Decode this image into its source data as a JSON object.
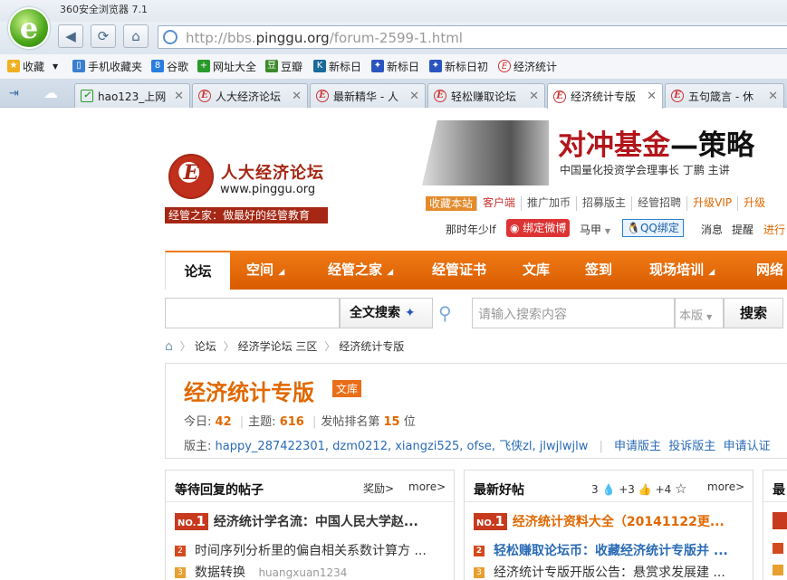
{
  "browser": {
    "app_title": "360安全浏览器 7.1",
    "logo_glyph": "e",
    "url_prefix": "http://bbs.",
    "url_domain": "pinggu.org",
    "url_path": "/forum-2599-1.html",
    "bookmarks": [
      "收藏",
      "手机收藏夹",
      "谷歌",
      "网址大全",
      "豆瓣",
      "新标日",
      "新标日",
      "新标日初",
      "经济统计"
    ],
    "tabs": [
      "hao123_上网",
      "人大经济论坛",
      "最新精华 - 人",
      "轻松赚取论坛",
      "经济统计专版",
      "五句箴言 - 休"
    ]
  },
  "site": {
    "name": "人大经济论坛",
    "url": "www.pinggu.org",
    "slogan": "经管之家：做最好的经管教育",
    "banner_title_red": "对冲基金",
    "banner_title_black": "—策略",
    "banner_sub": "中国量化投资学会理事长 丁鹏 主讲",
    "toplinks": [
      "收藏本站",
      "客户端",
      "推广加币",
      "招募版主",
      "经管招聘",
      "升级VIP",
      "升级"
    ],
    "user": {
      "name": "那时年少lf",
      "weibo": "绑定微博",
      "horse": "马甲",
      "qq": "QQ绑定",
      "msg": "消息",
      "remind": "提醒",
      "more": "进行"
    }
  },
  "nav": [
    "论坛",
    "空间",
    "经管之家",
    "经管证书",
    "文库",
    "签到",
    "现场培训",
    "网络"
  ],
  "search": {
    "fulltext": "全文搜索",
    "placeholder": "请输入搜索内容",
    "scope": "本版",
    "button": "搜索"
  },
  "breadcrumb": [
    "论坛",
    "经济学论坛 三区",
    "经济统计专版"
  ],
  "forum": {
    "title": "经济统计专版",
    "badge": "文库",
    "today_label": "今日:",
    "today": "42",
    "topics_label": "主题:",
    "topics": "616",
    "rank_label": "发帖排名第",
    "rank": "15",
    "rank_unit": "位",
    "mods_label": "版主:",
    "mods": "happy_287422301, dzm0212, xiangzi525, ofse, 飞侠zl, jlwjlwjlw",
    "actions": [
      "申请版主",
      "投诉版主",
      "申请认证"
    ]
  },
  "panels": [
    {
      "title": "等待回复的帖子",
      "reward": "奖励>",
      "more": "more>",
      "rows": [
        {
          "rank": "1",
          "text": "经济统计学名流：中国人民大学赵..."
        },
        {
          "rank": "2",
          "text": "时间序列分析里的偏自相关系数计算方 ..."
        },
        {
          "rank": "3",
          "text": "数据转换",
          "author": "huangxuan1234"
        }
      ]
    },
    {
      "title": "最新好帖",
      "stats": "3",
      "stats2": "+3",
      "stats3": "+4",
      "more": "more>",
      "rows": [
        {
          "rank": "1",
          "text": "经济统计资料大全（20141122更..."
        },
        {
          "rank": "2",
          "text": "轻松赚取论坛币：收藏经济统计专版并 ..."
        },
        {
          "rank": "3",
          "text": "经济统计专版开版公告：悬赏求发展建 ..."
        }
      ]
    },
    {
      "title": "最"
    }
  ]
}
